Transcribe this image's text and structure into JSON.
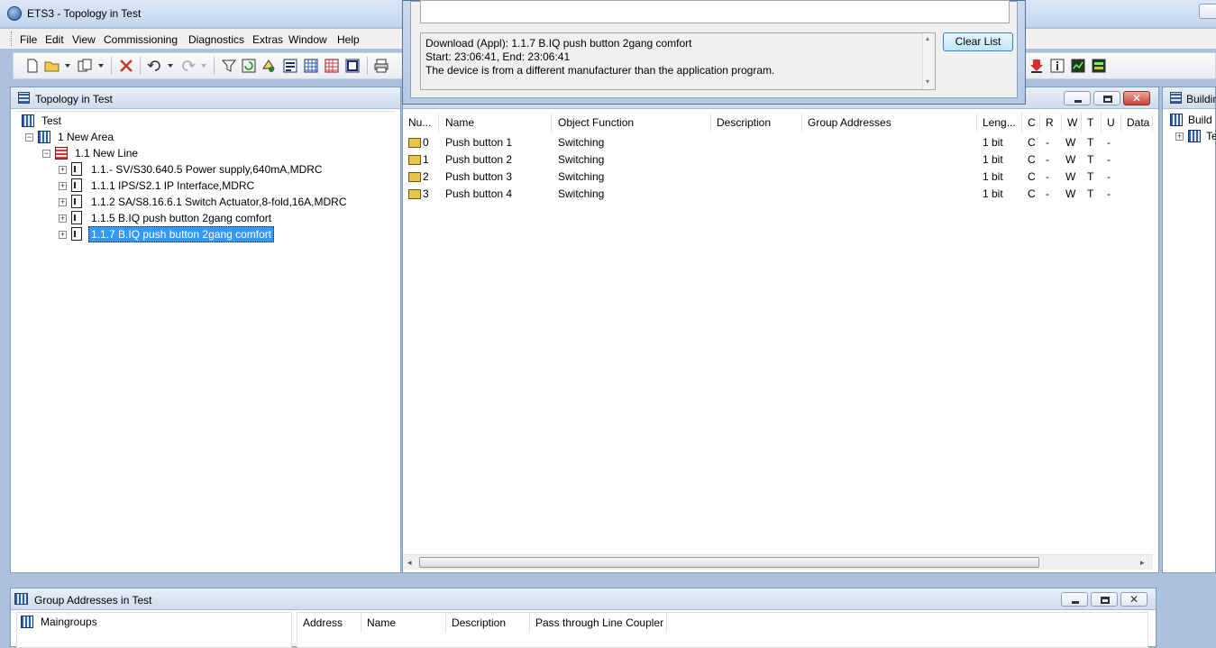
{
  "window": {
    "title": "ETS3 - Topology in Test"
  },
  "menu": [
    "File",
    "Edit",
    "View",
    "Commissioning",
    "Diagnostics",
    "Extras",
    "Window",
    "Help"
  ],
  "dialog": {
    "log_lines": [
      "Download (Appl): 1.1.7 B.IQ push button 2gang comfort",
      "Start: 23:06:41, End: 23:06:41",
      "The device is from a different manufacturer than the application program."
    ],
    "clear_button": "Clear List"
  },
  "topology": {
    "title": "Topology in Test",
    "tree": [
      {
        "label": "Test",
        "type": "project"
      },
      {
        "label": "1 New Area",
        "type": "area"
      },
      {
        "label": "1.1 New Line",
        "type": "line"
      },
      {
        "label": "1.1.- SV/S30.640.5 Power supply,640mA,MDRC",
        "type": "device"
      },
      {
        "label": "1.1.1 IPS/S2.1 IP Interface,MDRC",
        "type": "device"
      },
      {
        "label": "1.1.2 SA/S8.16.6.1 Switch Actuator,8-fold,16A,MDRC",
        "type": "device"
      },
      {
        "label": "1.1.5 B.IQ push button 2gang comfort",
        "type": "device"
      },
      {
        "label": "1.1.7 B.IQ push button 2gang comfort",
        "type": "device",
        "selected": true
      }
    ]
  },
  "objects": {
    "columns": [
      "Nu...",
      "Name",
      "Object Function",
      "Description",
      "Group Addresses",
      "Leng...",
      "C",
      "R",
      "W",
      "T",
      "U",
      "Data"
    ],
    "rows": [
      {
        "num": "0",
        "name": "Push button 1",
        "function": "Switching",
        "length": "1 bit",
        "c": "C",
        "r": "-",
        "w": "W",
        "t": "T",
        "u": "-"
      },
      {
        "num": "1",
        "name": "Push button 2",
        "function": "Switching",
        "length": "1 bit",
        "c": "C",
        "r": "-",
        "w": "W",
        "t": "T",
        "u": "-"
      },
      {
        "num": "2",
        "name": "Push button 3",
        "function": "Switching",
        "length": "1 bit",
        "c": "C",
        "r": "-",
        "w": "W",
        "t": "T",
        "u": "-"
      },
      {
        "num": "3",
        "name": "Push button 4",
        "function": "Switching",
        "length": "1 bit",
        "c": "C",
        "r": "-",
        "w": "W",
        "t": "T",
        "u": "-"
      }
    ]
  },
  "buildings": {
    "title": "Buildin",
    "tree": [
      "Build",
      "Te"
    ]
  },
  "group_addresses": {
    "title": "Group Addresses in Test",
    "tree_root": "Maingroups",
    "columns": [
      "Address",
      "Name",
      "Description",
      "Pass through Line Coupler"
    ]
  }
}
